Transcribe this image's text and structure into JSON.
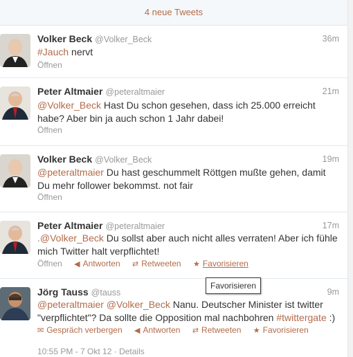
{
  "banner": {
    "new_tweets": "4 neue Tweets"
  },
  "tweets": [
    {
      "name": "Volker Beck",
      "handle": "@Volker_Beck",
      "time": "36m",
      "parts": [
        {
          "t": "#Jauch",
          "link": true
        },
        {
          "t": " nervt",
          "link": false
        }
      ],
      "open_label": "Öffnen"
    },
    {
      "name": "Peter Altmaier",
      "handle": "@peteraltmaier",
      "time": "21m",
      "parts": [
        {
          "t": "@Volker_Beck",
          "link": true
        },
        {
          "t": " Hast Du schon gesehen, dass ich 25.000 erreicht habe? Aber bin ja auch schon 1 Jahr dabei!",
          "link": false
        }
      ],
      "open_label": "Öffnen"
    },
    {
      "name": "Volker Beck",
      "handle": "@Volker_Beck",
      "time": "19m",
      "parts": [
        {
          "t": "@peteraltmaier",
          "link": true
        },
        {
          "t": " Du hast geschummelt Röttgen mußte gehen, damit Du mehr follower bekommst. not fair",
          "link": false
        }
      ],
      "open_label": "Öffnen"
    },
    {
      "name": "Peter Altmaier",
      "handle": "@peteraltmaier",
      "time": "17m",
      "parts": [
        {
          "t": ".@Volker_Beck",
          "link": true
        },
        {
          "t": " Du sollst aber auch nicht alles verraten! Aber ich fühle mich Twitter halt verpflichtet!",
          "link": false
        }
      ],
      "open_label": "Öffnen",
      "reply_label": "Antworten",
      "retweet_label": "Retweeten",
      "favorite_label": "Favorisieren"
    },
    {
      "name": "Jörg Tauss",
      "handle": "@tauss",
      "time": "9m",
      "parts": [
        {
          "t": "@peteraltmaier @Volker_Beck",
          "link": true
        },
        {
          "t": " Nanu. Deutscher Minister ist twitter \"verpflichtet\"? Da sollte die Opposition mal nachbohren ",
          "link": false
        },
        {
          "t": "#twittergate",
          "link": true
        },
        {
          "t": " :)",
          "link": false
        }
      ],
      "conversation_label": "Gespräch verbergen",
      "reply_label": "Antworten",
      "retweet_label": "Retweeten",
      "favorite_label": "Favorisieren",
      "timestamp": "10:55 PM - 7 Okt 12",
      "details_label": "Details"
    }
  ],
  "tooltip": {
    "text": "Favorisieren"
  },
  "colors": {
    "link": "#b36b4a",
    "muted": "#999999"
  }
}
